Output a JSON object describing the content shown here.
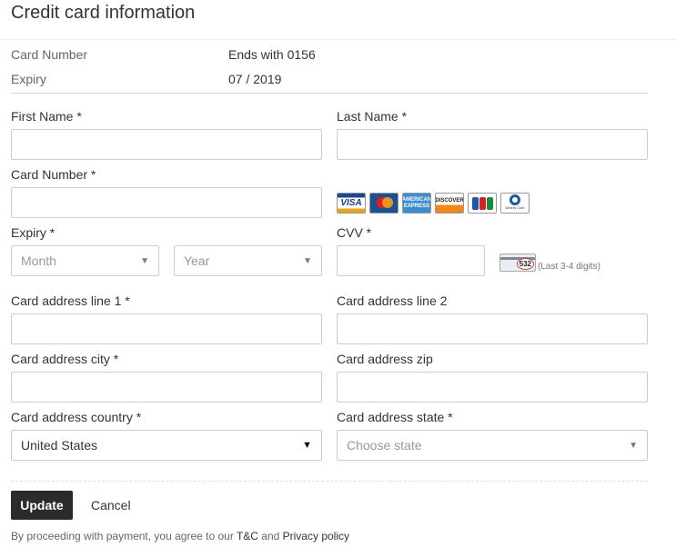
{
  "page": {
    "title": "Credit card information"
  },
  "summary": {
    "card_number_label": "Card Number",
    "card_number_value": "Ends with 0156",
    "expiry_label": "Expiry",
    "expiry_value": "07 / 2019"
  },
  "form": {
    "first_name": {
      "label": "First Name *",
      "value": ""
    },
    "last_name": {
      "label": "Last Name *",
      "value": ""
    },
    "card_number": {
      "label": "Card Number *",
      "value": ""
    },
    "card_logos": [
      "visa-icon",
      "mastercard-icon",
      "amex-icon",
      "discover-icon",
      "jcb-icon",
      "diners-club-icon"
    ],
    "card_logo_text": {
      "visa": "VISA",
      "amex": "AMERICAN EXPRESS",
      "discover": "DISCOVER",
      "diners": "Diners Club"
    },
    "expiry": {
      "label": "Expiry *",
      "month_placeholder": "Month",
      "year_placeholder": "Year"
    },
    "cvv": {
      "label": "CVV *",
      "value": "",
      "hint": "(Last 3-4 digits)",
      "example_digits": "532"
    },
    "address_line1": {
      "label": "Card address line 1 *",
      "value": ""
    },
    "address_line2": {
      "label": "Card address line 2",
      "value": ""
    },
    "city": {
      "label": "Card address city *",
      "value": ""
    },
    "zip": {
      "label": "Card address zip",
      "value": ""
    },
    "country": {
      "label": "Card address country *",
      "value": "United States"
    },
    "state": {
      "label": "Card address state *",
      "placeholder": "Choose state"
    }
  },
  "actions": {
    "update_label": "Update",
    "cancel_label": "Cancel"
  },
  "footer": {
    "prefix": "By proceeding with payment, you agree to our ",
    "tc_link": "T&C",
    "and": " and ",
    "privacy_link": "Privacy policy"
  },
  "colors": {
    "button_bg": "#2b2b2b",
    "border": "#cccccc",
    "placeholder": "#999999"
  }
}
